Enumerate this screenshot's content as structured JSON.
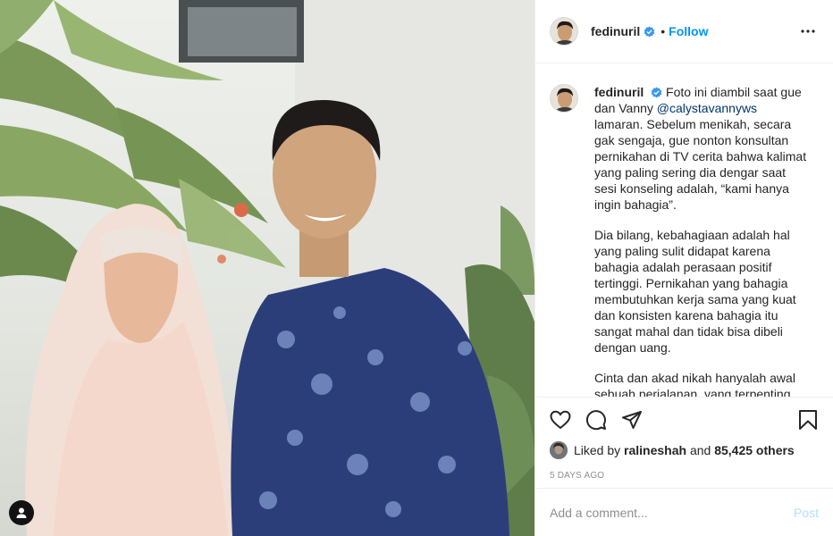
{
  "post": {
    "username": "fedinuril",
    "follow_label": "Follow",
    "separator": "•",
    "caption": {
      "username": "fedinuril",
      "para1_a": "Foto ini diambil saat gue dan Vanny ",
      "mention": "@calystavannyws",
      "para1_b": " lamaran. Sebelum menikah, secara gak sengaja, gue nonton konsultan pernikahan di TV cerita bahwa kalimat yang paling sering dia dengar saat sesi konseling adalah, “kami hanya ingin bahagia”.",
      "para2": "Dia bilang, kebahagiaan adalah hal yang paling sulit didapat karena bahagia adalah perasaan positif tertinggi. Pernikahan yang bahagia membutuhkan kerja sama yang kuat dan konsisten karena bahagia itu sangat mahal dan tidak bisa dibeli dengan uang.",
      "para3": "Cinta dan akad nikah hanyalah awal sebuah perjalanan, yang terpenting"
    },
    "likes": {
      "prefix": "Liked by",
      "user": "ralineshah",
      "joiner": "and",
      "others": "85,425 others"
    },
    "timestamp": "5 DAYS AGO",
    "comment": {
      "placeholder": "Add a comment...",
      "post_label": "Post"
    }
  },
  "icons": {
    "verified": "verified-badge-icon",
    "more": "more-options-icon",
    "like": "heart-icon",
    "comment": "comment-icon",
    "share": "share-icon",
    "save": "bookmark-icon",
    "tag": "user-tag-icon"
  },
  "colors": {
    "accent": "#0095f6",
    "text": "#262626",
    "muted": "#8e8e8e",
    "border": "#efefef",
    "post_disabled": "#b2dffc"
  }
}
